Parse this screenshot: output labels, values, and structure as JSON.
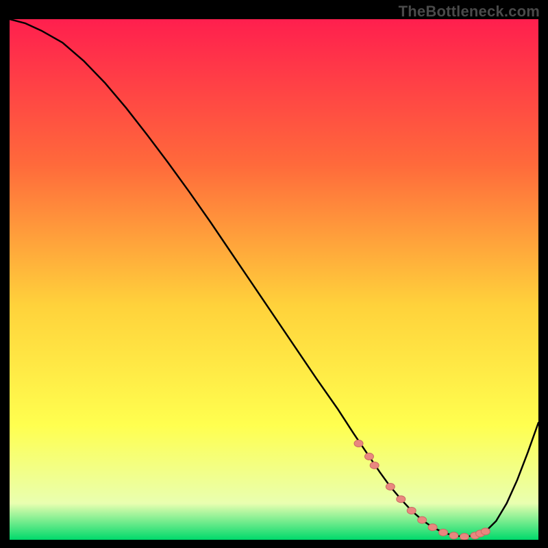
{
  "watermark": "TheBottleneck.com",
  "colors": {
    "bg_black": "#000000",
    "curve": "#000000",
    "marker_fill": "#e9877f",
    "marker_stroke": "#c96b63",
    "grad_top": "#ff1f4e",
    "grad_mid1": "#ff6a3b",
    "grad_mid2": "#ffd23b",
    "grad_mid3": "#ffff4f",
    "grad_pale": "#e9ffb0",
    "grad_green": "#00d96b"
  },
  "chart_data": {
    "type": "line",
    "title": "",
    "xlabel": "",
    "ylabel": "",
    "xlim": [
      0,
      100
    ],
    "ylim": [
      0,
      100
    ],
    "grid": false,
    "legend": false,
    "series": [
      {
        "name": "curve",
        "x": [
          0,
          3,
          6,
          10,
          14,
          18,
          22,
          26,
          30,
          34,
          38,
          42,
          46,
          50,
          54,
          58,
          62,
          65,
          68,
          70,
          72,
          74,
          76,
          78,
          80,
          82,
          84,
          86,
          88,
          90,
          92,
          94,
          96,
          98,
          100
        ],
        "y": [
          100,
          99.2,
          97.8,
          95.5,
          92.0,
          87.8,
          83.0,
          77.8,
          72.4,
          66.8,
          61.0,
          55.0,
          49.0,
          43.0,
          37.0,
          31.0,
          25.2,
          20.5,
          16.0,
          13.0,
          10.2,
          7.8,
          5.6,
          3.8,
          2.4,
          1.4,
          0.8,
          0.6,
          0.8,
          1.6,
          3.6,
          7.0,
          11.5,
          16.8,
          22.5
        ]
      }
    ],
    "markers": {
      "name": "highlight-points",
      "x": [
        66,
        68,
        69,
        72,
        74,
        76,
        78,
        80,
        82,
        84,
        86,
        88,
        89,
        90
      ],
      "y": [
        18.5,
        16.0,
        14.3,
        10.2,
        7.8,
        5.6,
        3.8,
        2.4,
        1.4,
        0.8,
        0.6,
        0.8,
        1.2,
        1.6
      ]
    }
  }
}
